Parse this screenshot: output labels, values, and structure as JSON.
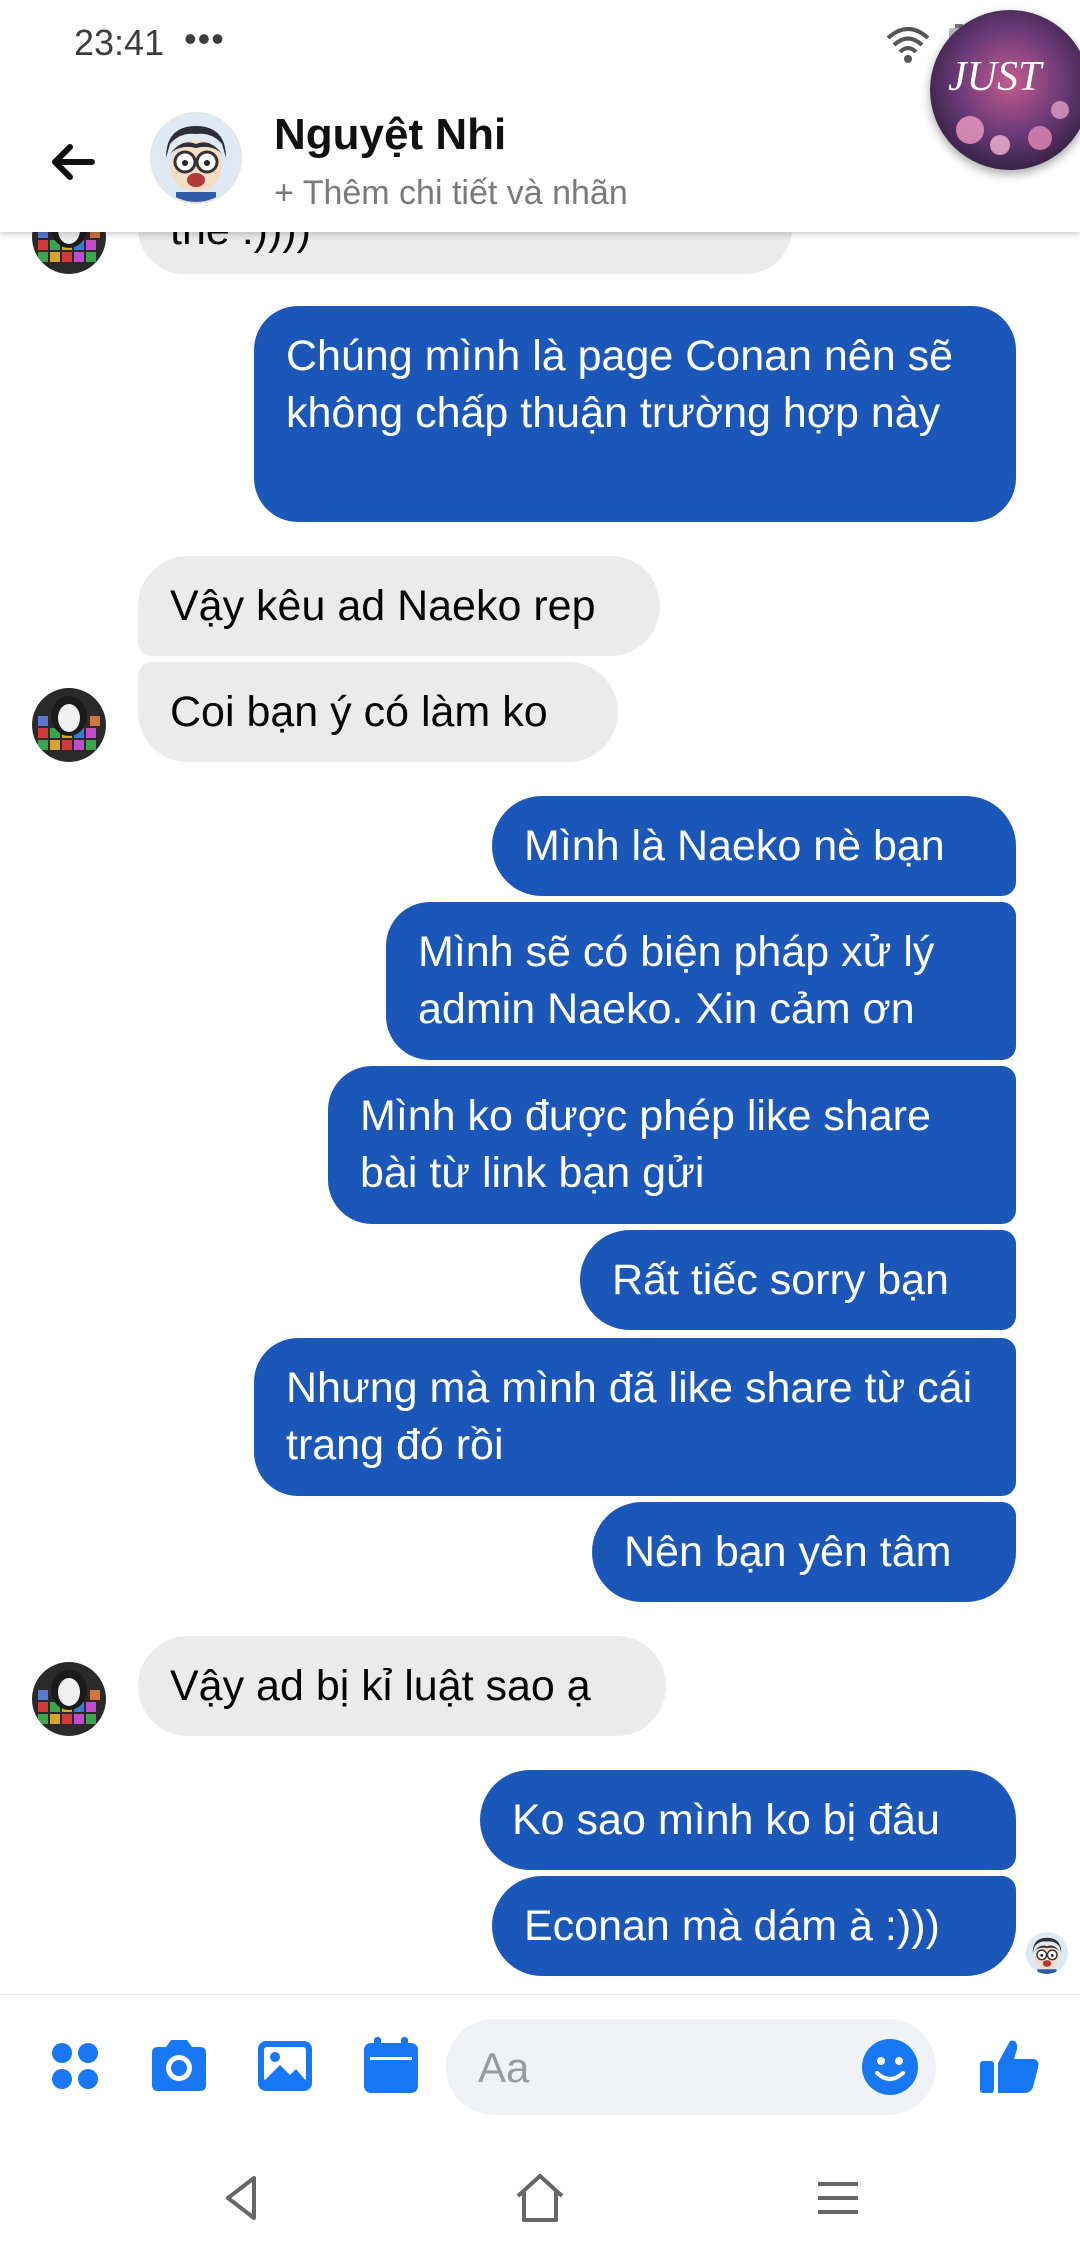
{
  "status_bar": {
    "time": "23:41",
    "dots": "•••"
  },
  "header": {
    "contact_name": "Nguyệt Nhi",
    "subtitle": "+ Thêm chi tiết và nhãn",
    "chathead_text": "JUST"
  },
  "messages": [
    {
      "direction": "in",
      "text": "thế :))))"
    },
    {
      "direction": "out",
      "text": "Chúng mình là page Conan nên sẽ không chấp thuận trường hợp này"
    },
    {
      "direction": "in",
      "text": "Vậy kêu ad Naeko rep"
    },
    {
      "direction": "in",
      "text": "Coi bạn ý có làm ko"
    },
    {
      "direction": "out",
      "text": "Mình là Naeko nè bạn"
    },
    {
      "direction": "out",
      "text": "Mình sẽ có biện pháp xử lý admin Naeko. Xin cảm ơn"
    },
    {
      "direction": "out",
      "text": "Mình ko được phép like share bài từ link bạn gửi"
    },
    {
      "direction": "out",
      "text": "Rất tiếc sorry bạn"
    },
    {
      "direction": "out",
      "text": "Nhưng mà mình đã like share từ cái trang đó rồi"
    },
    {
      "direction": "out",
      "text": "Nên bạn yên tâm"
    },
    {
      "direction": "in",
      "text": "Vậy ad bị kỉ luật sao ạ"
    },
    {
      "direction": "out",
      "text": "Ko sao mình ko bị đâu"
    },
    {
      "direction": "out",
      "text": "Econan mà dám à :)))"
    }
  ],
  "composer": {
    "placeholder": "Aa"
  },
  "colors": {
    "outgoing_bubble": "#1b57b8",
    "incoming_bubble": "#ebebeb",
    "accent": "#1877f2"
  },
  "icons": {
    "composer": [
      "apps-icon",
      "camera-icon",
      "gallery-icon",
      "calendar-icon",
      "emoji-icon",
      "thumbs-up-icon"
    ],
    "header": [
      "back-arrow-icon"
    ],
    "navigation": [
      "nav-back-icon",
      "nav-home-icon",
      "nav-menu-icon"
    ]
  }
}
